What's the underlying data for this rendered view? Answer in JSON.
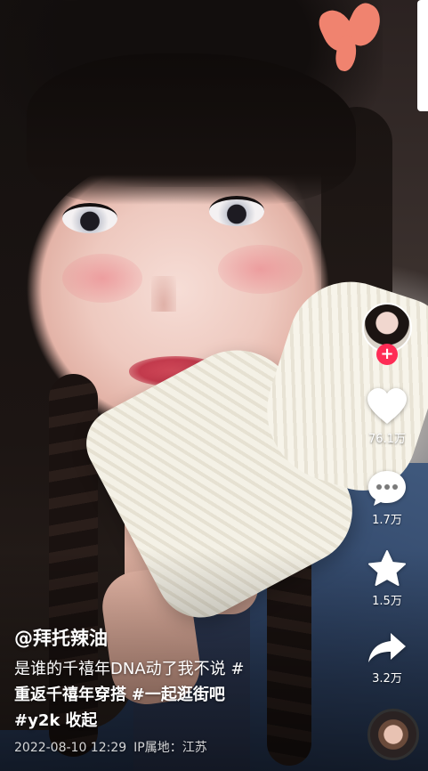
{
  "video": {
    "description": "Selfie video with a girl in white knit gloves and denim vest"
  },
  "creator": {
    "username": "@拜托辣油",
    "avatar_icon": "creator-avatar",
    "follow_symbol": "+"
  },
  "actions": {
    "like_count": "76.1万",
    "comment_count": "1.7万",
    "favorite_count": "1.5万",
    "share_count": "3.2万"
  },
  "caption": {
    "line1": "是谁的千禧年DNA动了我不说 #",
    "line2_tag1": "重返千禧年穿搭",
    "line2_tag2": "#一起逛街吧",
    "line3_tag": "#y2k",
    "more_label": "收起"
  },
  "meta": {
    "timestamp": "2022-08-10 12:29",
    "ip_location": "IP属地：江苏"
  },
  "colors": {
    "accent": "#fe2c55",
    "text": "#ffffff"
  }
}
